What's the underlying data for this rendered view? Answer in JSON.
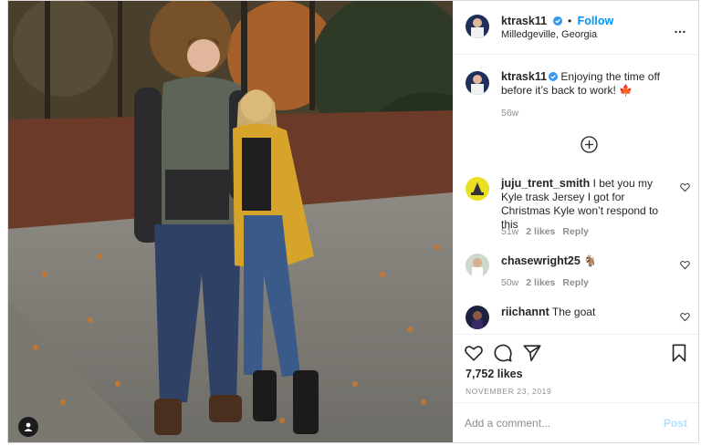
{
  "post": {
    "username": "ktrask11",
    "verified": true,
    "follow_label": "Follow",
    "location": "Milledgeville, Georgia",
    "more_icon": "…",
    "caption": {
      "username": "ktrask11",
      "text": "Enjoying the time off before it’s back to work! 🍁",
      "age": "56w"
    },
    "load_more_icon": "plus-circle-icon",
    "comments": [
      {
        "username": "juju_trent_smith",
        "text": "I bet you my Kyle trask Jersey I got for Christmas Kyle won’t respond to this",
        "age": "51w",
        "likes": "2 likes",
        "reply": "Reply"
      },
      {
        "username": "chasewright25",
        "text": "🐐",
        "age": "50w",
        "likes": "2 likes",
        "reply": "Reply"
      },
      {
        "username": "riichannt",
        "text": "The goat",
        "age": "",
        "likes": "",
        "reply": ""
      }
    ],
    "likes_count": "7,752 likes",
    "date": "NOVEMBER 23, 2019",
    "add_comment_placeholder": "Add a comment...",
    "post_button": "Post"
  },
  "colors": {
    "link_blue": "#0095f6",
    "post_disabled": "#b2dffc",
    "muted": "#8e8e8e",
    "text": "#262626"
  }
}
